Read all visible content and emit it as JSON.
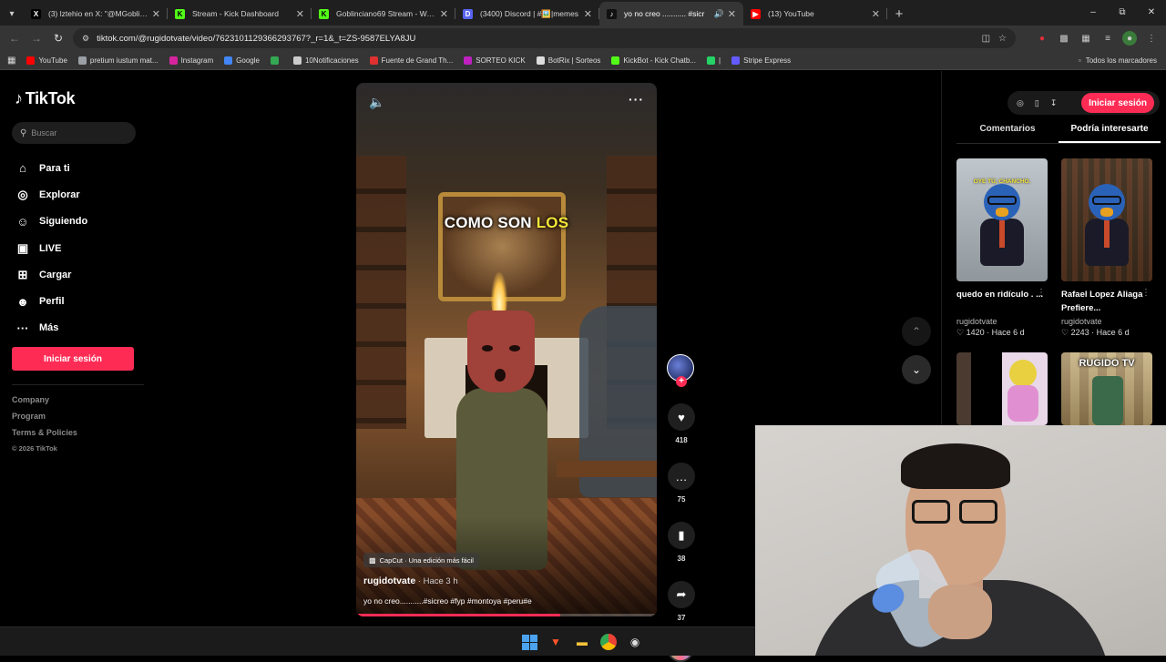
{
  "browser": {
    "tabs": [
      {
        "label": "(3) lztehio en X: \"@MGoblincia",
        "favicon": "X",
        "color": "#000000",
        "active": false
      },
      {
        "label": "Stream - Kick Dashboard",
        "favicon": "K",
        "color": "#53fc18",
        "active": false
      },
      {
        "label": "Goblinciano69 Stream - Watch",
        "favicon": "K",
        "color": "#53fc18",
        "active": false
      },
      {
        "label": "(3400) Discord | #🖼️|memes",
        "favicon": "D",
        "color": "#5865f2",
        "active": false
      },
      {
        "label": "yo no creo ........... #sicr",
        "favicon": "♪",
        "color": "#111111",
        "active": true
      },
      {
        "label": "(13) YouTube",
        "favicon": "▶",
        "color": "#ff0000",
        "active": false
      }
    ],
    "new_tab_glyph": "+",
    "window_controls": [
      "–",
      "⧉",
      "✕"
    ],
    "url": "tiktok.com/@rugidotvate/video/7623101129366293767?_r=1&_t=ZS-9587ELYA8JU",
    "bookmarks": [
      {
        "label": "YouTube",
        "color": "#ff0000"
      },
      {
        "label": "pretium iustum mat...",
        "color": "#9aa0a6"
      },
      {
        "label": "Instagram",
        "color": "#d6249f"
      },
      {
        "label": "Google",
        "color": "#4285f4"
      },
      {
        "label": "",
        "color": "#34a853"
      },
      {
        "label": "10Notificaciones",
        "color": "#cccccc"
      },
      {
        "label": "Fuente de Grand Th...",
        "color": "#e03030"
      },
      {
        "label": "SORTEO KICK",
        "color": "#c020c0"
      },
      {
        "label": "BotRix | Sorteos",
        "color": "#dddddd"
      },
      {
        "label": "KickBot - Kick Chatb...",
        "color": "#53fc18"
      },
      {
        "label": "|",
        "color": "#25d366"
      },
      {
        "label": "Stripe Express",
        "color": "#635bff"
      }
    ],
    "all_bookmarks": "Todos los marcadores"
  },
  "sidebar": {
    "logo": "TikTok",
    "search_placeholder": "Buscar",
    "nav": [
      {
        "label": "Para ti",
        "icon": "home-icon",
        "glyph": "⌂"
      },
      {
        "label": "Explorar",
        "icon": "compass-icon",
        "glyph": "◎"
      },
      {
        "label": "Siguiendo",
        "icon": "following-icon",
        "glyph": "☺"
      },
      {
        "label": "LIVE",
        "icon": "live-icon",
        "glyph": "▣"
      },
      {
        "label": "Cargar",
        "icon": "upload-icon",
        "glyph": "⊞"
      },
      {
        "label": "Perfil",
        "icon": "profile-icon",
        "glyph": "☻"
      },
      {
        "label": "Más",
        "icon": "more-icon",
        "glyph": "···"
      }
    ],
    "login": "Iniciar sesión",
    "footer": [
      "Company",
      "Program",
      "Terms & Policies"
    ],
    "copyright": "© 2026 TikTok"
  },
  "video": {
    "caption_main": "COMO SON",
    "caption_highlight": "LOS",
    "capcut": "CapCut · Una edición más fácil",
    "author": "rugidotvate",
    "ago": " · Hace 3 h",
    "description": "yo no creo...........#sicreo #fyp #montoya #peru#e",
    "progress": 0.68
  },
  "actions": {
    "likes": "418",
    "comments": "75",
    "saves": "38",
    "shares": "37"
  },
  "right_panel": {
    "login": "Iniciar sesión",
    "tabs": [
      "Comentarios",
      "Podría interesarte"
    ],
    "active_tab": 1,
    "cards": [
      {
        "title": "quedo en ridículo . ...",
        "user": "rugidotvate",
        "likes": "1420",
        "ago": "Hace 6 d",
        "overlay": "OYE TÚ, CHANCHO."
      },
      {
        "title": "Rafael Lopez Aliaga Prefiere...",
        "user": "rugidotvate",
        "likes": "2243",
        "ago": "Hace 6 d",
        "overlay": ""
      },
      {
        "overlay": ""
      },
      {
        "overlay": "RUGIDO TV"
      }
    ]
  },
  "colors": {
    "accent": "#fe2c55",
    "caption_highlight": "#f5e63a"
  }
}
